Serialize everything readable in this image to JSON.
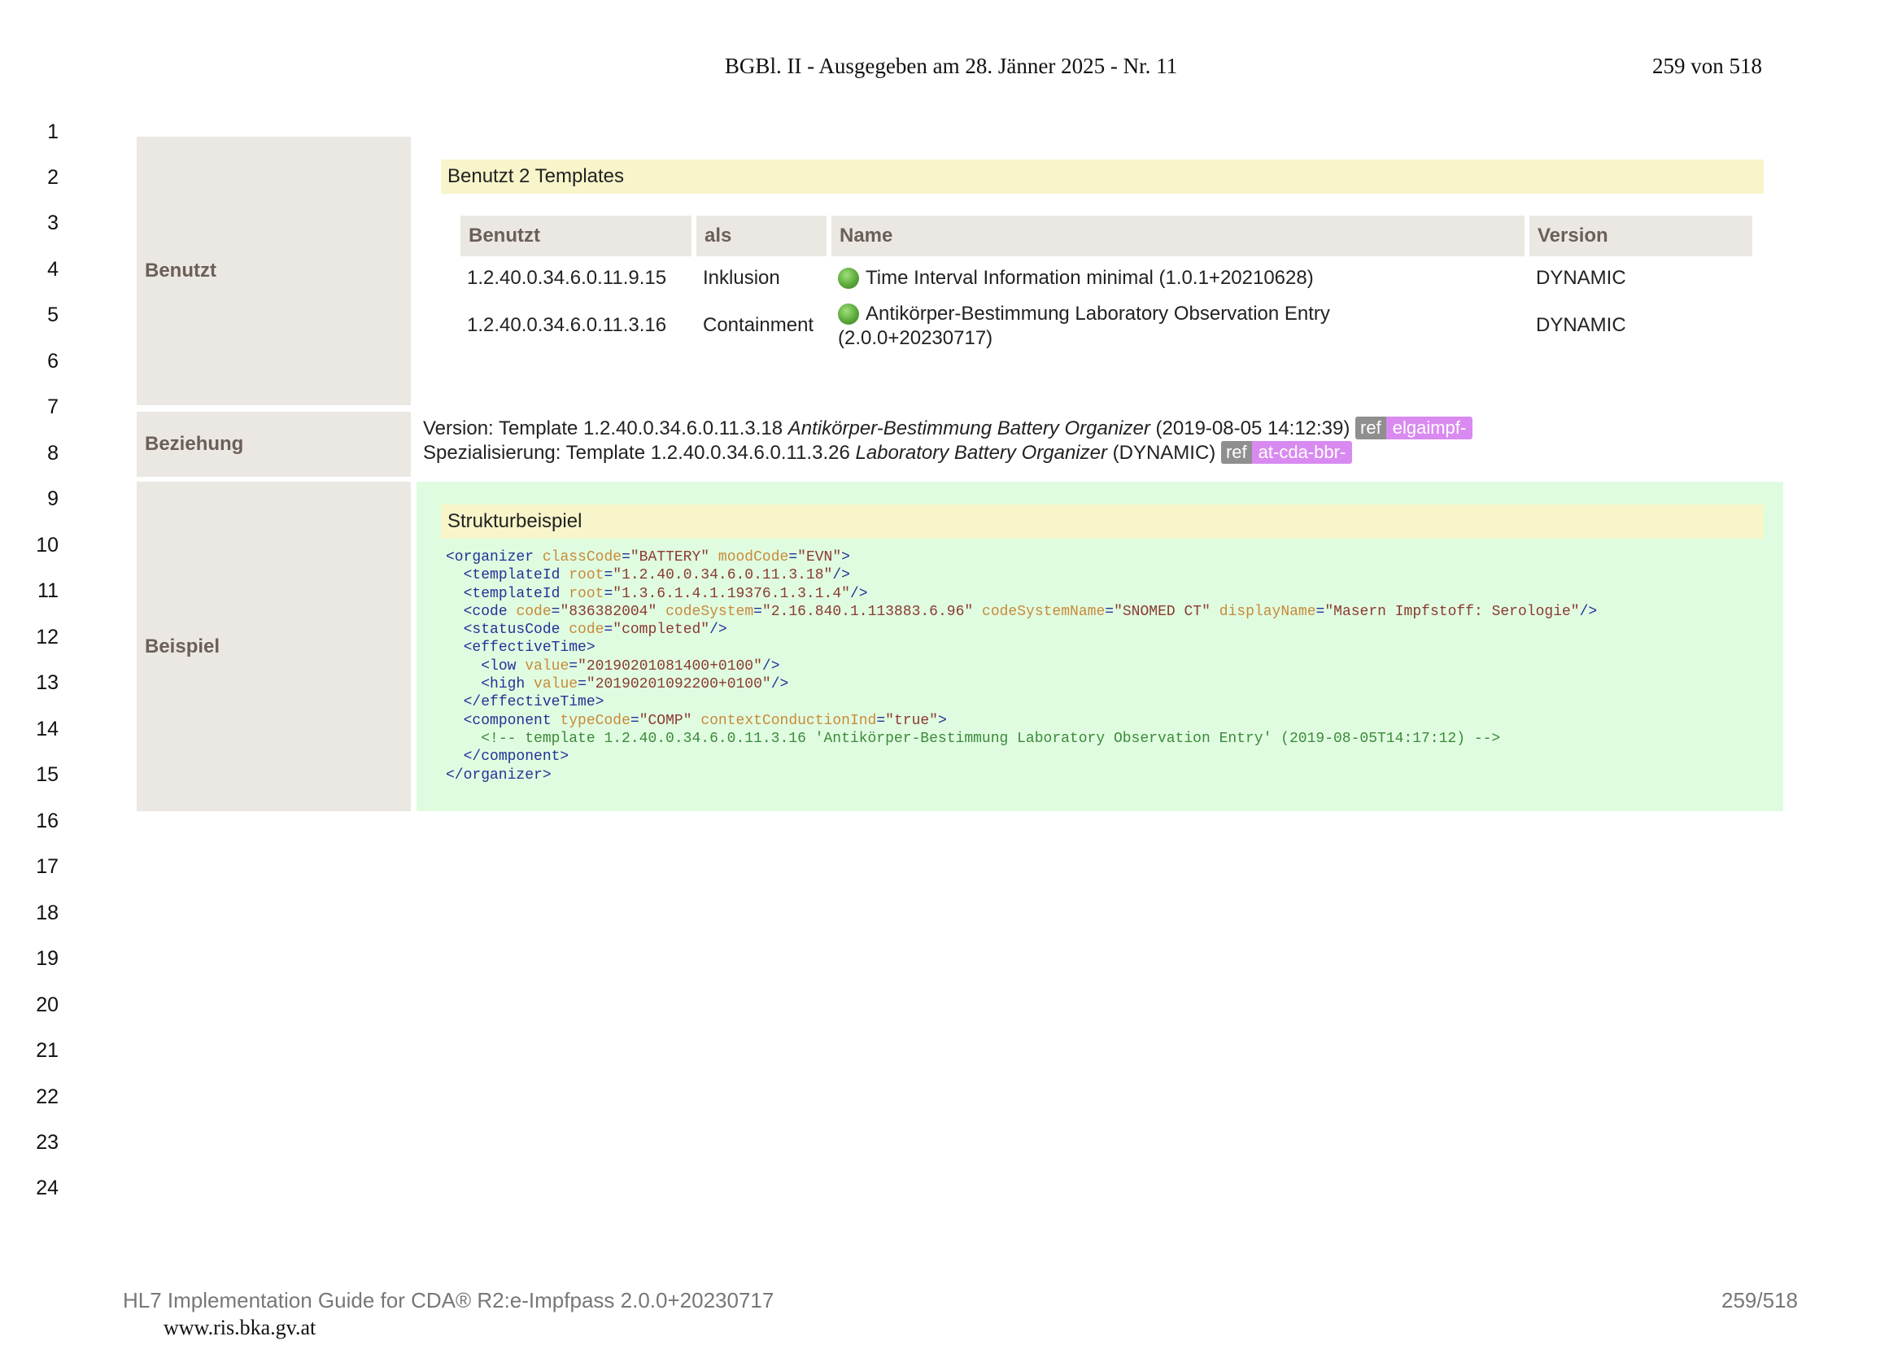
{
  "header": {
    "title": "BGBl. II - Ausgegeben am 28. Jänner 2025 - Nr. 11",
    "page": "259 von 518"
  },
  "line_numbers": [
    "1",
    "2",
    "3",
    "4",
    "5",
    "6",
    "7",
    "8",
    "9",
    "10",
    "11",
    "12",
    "13",
    "14",
    "15",
    "16",
    "17",
    "18",
    "19",
    "20",
    "21",
    "22",
    "23",
    "24"
  ],
  "labels": {
    "benutzt": "Benutzt",
    "beziehung": "Beziehung",
    "beispiel": "Beispiel"
  },
  "benutzt": {
    "caption": "Benutzt 2 Templates",
    "columns": [
      "Benutzt",
      "als",
      "Name",
      "Version"
    ],
    "rows": [
      {
        "id": "1.2.40.0.34.6.0.11.9.15",
        "als": "Inklusion",
        "name": "Time Interval Information minimal (1.0.1+20210628)",
        "version": "DYNAMIC"
      },
      {
        "id": "1.2.40.0.34.6.0.11.3.16",
        "als": "Containment",
        "name_line1": "Antikörper-Bestimmung Laboratory Observation Entry",
        "name_line2": "(2.0.0+20230717)",
        "version": "DYNAMIC"
      }
    ]
  },
  "beziehung": {
    "line1_prefix": "Version: Template 1.2.40.0.34.6.0.11.3.18 ",
    "line1_name": "Antikörper-Bestimmung Battery Organizer",
    "line1_suffix": " (2019‑08‑05 14:12:39) ",
    "line1_ref": "ref",
    "line1_badge": "elgaimpf-",
    "line2_prefix": "Spezialisierung: Template 1.2.40.0.34.6.0.11.3.26 ",
    "line2_name": "Laboratory Battery Organizer",
    "line2_suffix": " (DYNAMIC) ",
    "line2_ref": "ref",
    "line2_badge": "at-cda-bbr-"
  },
  "beispiel": {
    "caption": "Strukturbeispiel",
    "code": {
      "l1": {
        "tag": "<organizer",
        "a1": "classCode",
        "v1": "\"BATTERY\"",
        "a2": "moodCode",
        "v2": "\"EVN\"",
        "end": ">"
      },
      "l2": {
        "tag": "<templateId",
        "a1": "root",
        "v1": "\"1.2.40.0.34.6.0.11.3.18\"",
        "end": "/>"
      },
      "l3": {
        "tag": "<templateId",
        "a1": "root",
        "v1": "\"1.3.6.1.4.1.19376.1.3.1.4\"",
        "end": "/>"
      },
      "l4": {
        "tag": "<code",
        "a1": "code",
        "v1": "\"836382004\"",
        "a2": "codeSystem",
        "v2": "\"2.16.840.1.113883.6.96\"",
        "a3": "codeSystemName",
        "v3": "\"SNOMED CT\"",
        "a4": "displayName",
        "v4": "\"Masern Impfstoff: Serologie\"",
        "end": "/>"
      },
      "l5": {
        "tag": "<statusCode",
        "a1": "code",
        "v1": "\"completed\"",
        "end": "/>"
      },
      "l6": {
        "tag": "<effectiveTime>"
      },
      "l7": {
        "tag": "<low",
        "a1": "value",
        "v1": "\"20190201081400+0100\"",
        "end": "/>"
      },
      "l8": {
        "tag": "<high",
        "a1": "value",
        "v1": "\"20190201092200+0100\"",
        "end": "/>"
      },
      "l9": {
        "tag": "</effectiveTime>"
      },
      "l10": {
        "tag": "<component",
        "a1": "typeCode",
        "v1": "\"COMP\"",
        "a2": "contextConductionInd",
        "v2": "\"true\"",
        "end": ">"
      },
      "l11": {
        "comment": "<!-- template 1.2.40.0.34.6.0.11.3.16 'Antikörper-Bestimmung Laboratory Observation Entry' (2019-08-05T14:17:12) -->"
      },
      "l12": {
        "tag": "</component>"
      },
      "l13": {
        "tag": "</organizer>"
      }
    }
  },
  "footer": {
    "left": "HL7 Implementation Guide for CDA® R2:e-Impfpass 2.0.0+20230717",
    "right": "259/518",
    "url": "www.ris.bka.gv.at"
  }
}
